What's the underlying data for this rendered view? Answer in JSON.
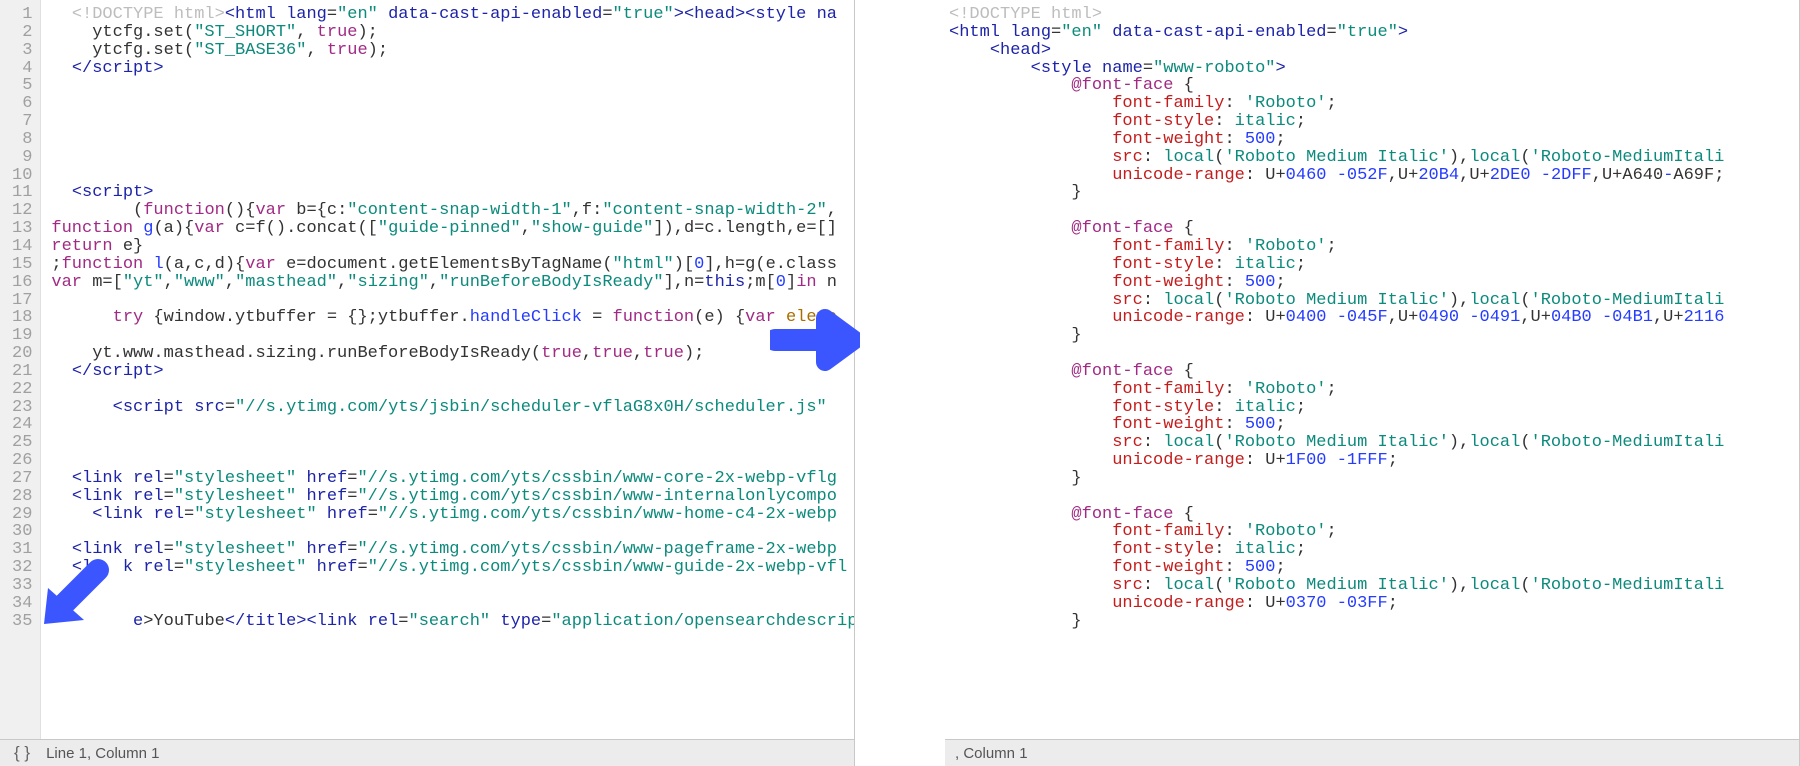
{
  "left": {
    "status": {
      "braces": "{ }",
      "location": "Line 1, Column 1"
    },
    "lines": [
      {
        "n": 1,
        "html": "  <span class='tok-doctype'>&lt;!DOCTYPE html&gt;</span><span class='tok-tag'>&lt;html</span> <span class='tok-attrname'>lang</span>=<span class='tok-string'>\"en\"</span> <span class='tok-attrname'>data-cast-api-enabled</span>=<span class='tok-string'>\"true\"</span><span class='tok-tag'>&gt;&lt;head&gt;&lt;style</span> <span class='tok-attrname'>na</span>"
      },
      {
        "n": 2,
        "html": "    ytcfg.set(<span class='tok-string'>\"ST_SHORT\"</span>, <span class='tok-keyword'>true</span>);"
      },
      {
        "n": 3,
        "html": "    ytcfg.set(<span class='tok-string'>\"ST_BASE36\"</span>, <span class='tok-keyword'>true</span>);"
      },
      {
        "n": 4,
        "html": "  <span class='tok-tag'>&lt;/script&gt;</span>"
      },
      {
        "n": 5,
        "html": " "
      },
      {
        "n": 6,
        "html": " "
      },
      {
        "n": 7,
        "html": " "
      },
      {
        "n": 8,
        "html": " "
      },
      {
        "n": 9,
        "html": " "
      },
      {
        "n": 10,
        "html": " "
      },
      {
        "n": 11,
        "html": "  <span class='tok-tag'>&lt;script&gt;</span>"
      },
      {
        "n": 12,
        "html": "        (<span class='tok-keyword'>function</span>(){<span class='tok-keyword'>var</span> b={c:<span class='tok-string'>\"content-snap-width-1\"</span>,f:<span class='tok-string'>\"content-snap-width-2\"</span>,"
      },
      {
        "n": 13,
        "html": "<span class='tok-keyword'>function</span> <span class='tok-func'>g</span>(a){<span class='tok-keyword'>var</span> c=f().concat([<span class='tok-string'>\"guide-pinned\"</span>,<span class='tok-string'>\"show-guide\"</span>]),d=c.length,e=[]"
      },
      {
        "n": 14,
        "html": "<span class='tok-keyword'>return</span> e}"
      },
      {
        "n": 15,
        "html": ";<span class='tok-keyword'>function</span> <span class='tok-func'>l</span>(a,c,d){<span class='tok-keyword'>var</span> e=document.getElementsByTagName(<span class='tok-string'>\"html\"</span>)[<span class='tok-num'>0</span>],h=g(e.class"
      },
      {
        "n": 16,
        "html": "<span class='tok-keyword'>var</span> m=[<span class='tok-string'>\"yt\"</span>,<span class='tok-string'>\"www\"</span>,<span class='tok-string'>\"masthead\"</span>,<span class='tok-string'>\"sizing\"</span>,<span class='tok-string'>\"runBeforeBodyIsReady\"</span>],n=<span class='tok-navy'>this</span>;m[<span class='tok-num'>0</span>]<span class='tok-keyword'>in</span> n"
      },
      {
        "n": 17,
        "html": " "
      },
      {
        "n": 18,
        "html": "      <span class='tok-keyword'>try</span> {window.ytbuffer = {};ytbuffer.<span class='tok-func'>handleClick</span> = <span class='tok-keyword'>function</span>(e) {<span class='tok-keyword'>var</span> <span class='tok-brown'>eleme</span>"
      },
      {
        "n": 19,
        "html": " "
      },
      {
        "n": 20,
        "html": "    yt.www.masthead.sizing.runBeforeBodyIsReady(<span class='tok-keyword'>true</span>,<span class='tok-keyword'>true</span>,<span class='tok-keyword'>true</span>);"
      },
      {
        "n": 21,
        "html": "  <span class='tok-tag'>&lt;/script&gt;</span>"
      },
      {
        "n": 22,
        "html": " "
      },
      {
        "n": 23,
        "html": "      <span class='tok-tag'>&lt;script</span> <span class='tok-attrname'>src</span>=<span class='tok-string'>\"//s.ytimg.com/yts/jsbin/scheduler-vflaG8x0H/scheduler.js\"</span>"
      },
      {
        "n": 24,
        "html": " "
      },
      {
        "n": 25,
        "html": " "
      },
      {
        "n": 26,
        "html": " "
      },
      {
        "n": 27,
        "html": "  <span class='tok-tag'>&lt;link</span> <span class='tok-attrname'>rel</span>=<span class='tok-string'>\"stylesheet\"</span> <span class='tok-attrname'>href</span>=<span class='tok-string'>\"//s.ytimg.com/yts/cssbin/www-core-2x-webp-vflg</span>"
      },
      {
        "n": 28,
        "html": "  <span class='tok-tag'>&lt;link</span> <span class='tok-attrname'>rel</span>=<span class='tok-string'>\"stylesheet\"</span> <span class='tok-attrname'>href</span>=<span class='tok-string'>\"//s.ytimg.com/yts/cssbin/www-internalonlycompo</span>"
      },
      {
        "n": 29,
        "html": "    <span class='tok-tag'>&lt;link</span> <span class='tok-attrname'>rel</span>=<span class='tok-string'>\"stylesheet\"</span> <span class='tok-attrname'>href</span>=<span class='tok-string'>\"//s.ytimg.com/yts/cssbin/www-home-c4-2x-webp</span>"
      },
      {
        "n": 30,
        "html": " "
      },
      {
        "n": 31,
        "html": "  <span class='tok-tag'>&lt;link</span> <span class='tok-attrname'>rel</span>=<span class='tok-string'>\"stylesheet\"</span> <span class='tok-attrname'>href</span>=<span class='tok-string'>\"//s.ytimg.com/yts/cssbin/www-pageframe-2x-webp</span>"
      },
      {
        "n": 32,
        "html": "  <span class='tok-tag'>&lt;l</span>   <span class='tok-attrname'>k rel</span>=<span class='tok-string'>\"stylesheet\"</span> <span class='tok-attrname'>href</span>=<span class='tok-string'>\"//s.ytimg.com/yts/cssbin/www-guide-2x-webp-vfl</span>"
      },
      {
        "n": 33,
        "html": " "
      },
      {
        "n": 34,
        "html": " "
      },
      {
        "n": 35,
        "html": "        <span class='tok-tag'>e</span>&gt;YouTube<span class='tok-tag'>&lt;/title&gt;&lt;link</span> <span class='tok-attrname'>rel</span>=<span class='tok-string'>\"search\"</span> <span class='tok-attrname'>type</span>=<span class='tok-string'>\"application/opensearchdescripti</span>"
      }
    ]
  },
  "right": {
    "status": {
      "location": ", Column 1"
    },
    "lines": [
      {
        "html": "<span class='tok-doctype'>&lt;!DOCTYPE html&gt;</span>"
      },
      {
        "html": "<span class='tok-tag'>&lt;html</span> <span class='tok-attrname'>lang</span>=<span class='tok-string'>\"en\"</span> <span class='tok-attrname'>data-cast-api-enabled</span>=<span class='tok-string'>\"true\"</span><span class='tok-tag'>&gt;</span>"
      },
      {
        "html": "    <span class='tok-tag'>&lt;head&gt;</span>"
      },
      {
        "html": "        <span class='tok-tag'>&lt;style</span> <span class='tok-attrname'>name</span>=<span class='tok-string'>\"www-roboto\"</span><span class='tok-tag'>&gt;</span>"
      },
      {
        "html": "            <span class='tok-keyword'>@font-face</span> {"
      },
      {
        "html": "                <span class='tok-red'>font-family</span>: <span class='tok-green'>'Roboto'</span>;"
      },
      {
        "html": "                <span class='tok-red'>font-style</span>: <span class='tok-green'>italic</span>;"
      },
      {
        "html": "                <span class='tok-red'>font-weight</span>: <span class='tok-num'>500</span>;"
      },
      {
        "html": "                <span class='tok-red'>src</span>: <span class='tok-green'>local</span>(<span class='tok-green'>'Roboto Medium Italic'</span>),<span class='tok-green'>local</span>(<span class='tok-green'>'Roboto-MediumItali</span>"
      },
      {
        "html": "                <span class='tok-red'>unicode-range</span>: U+<span class='tok-num'>0460</span> <span class='tok-num'>-052F</span>,U+<span class='tok-num'>20B4</span>,U+<span class='tok-num'>2DE0</span> <span class='tok-num'>-2DFF</span>,U+A640<span class='tok-num'>-</span>A69F;"
      },
      {
        "html": "            }"
      },
      {
        "html": " "
      },
      {
        "html": "            <span class='tok-keyword'>@font-face</span> {"
      },
      {
        "html": "                <span class='tok-red'>font-family</span>: <span class='tok-green'>'Roboto'</span>;"
      },
      {
        "html": "                <span class='tok-red'>font-style</span>: <span class='tok-green'>italic</span>;"
      },
      {
        "html": "                <span class='tok-red'>font-weight</span>: <span class='tok-num'>500</span>;"
      },
      {
        "html": "                <span class='tok-red'>src</span>: <span class='tok-green'>local</span>(<span class='tok-green'>'Roboto Medium Italic'</span>),<span class='tok-green'>local</span>(<span class='tok-green'>'Roboto-MediumItali</span>"
      },
      {
        "html": "                <span class='tok-red'>unicode-range</span>: U+<span class='tok-num'>0400</span> <span class='tok-num'>-045F</span>,U+<span class='tok-num'>0490</span> <span class='tok-num'>-0491</span>,U+<span class='tok-num'>04B0</span> <span class='tok-num'>-04B1</span>,U+<span class='tok-num'>2116</span>"
      },
      {
        "html": "            }"
      },
      {
        "html": " "
      },
      {
        "html": "            <span class='tok-keyword'>@font-face</span> {"
      },
      {
        "html": "                <span class='tok-red'>font-family</span>: <span class='tok-green'>'Roboto'</span>;"
      },
      {
        "html": "                <span class='tok-red'>font-style</span>: <span class='tok-green'>italic</span>;"
      },
      {
        "html": "                <span class='tok-red'>font-weight</span>: <span class='tok-num'>500</span>;"
      },
      {
        "html": "                <span class='tok-red'>src</span>: <span class='tok-green'>local</span>(<span class='tok-green'>'Roboto Medium Italic'</span>),<span class='tok-green'>local</span>(<span class='tok-green'>'Roboto-MediumItali</span>"
      },
      {
        "html": "                <span class='tok-red'>unicode-range</span>: U+<span class='tok-num'>1F00</span> <span class='tok-num'>-1FFF</span>;"
      },
      {
        "html": "            }"
      },
      {
        "html": " "
      },
      {
        "html": "            <span class='tok-keyword'>@font-face</span> {"
      },
      {
        "html": "                <span class='tok-red'>font-family</span>: <span class='tok-green'>'Roboto'</span>;"
      },
      {
        "html": "                <span class='tok-red'>font-style</span>: <span class='tok-green'>italic</span>;"
      },
      {
        "html": "                <span class='tok-red'>font-weight</span>: <span class='tok-num'>500</span>;"
      },
      {
        "html": "                <span class='tok-red'>src</span>: <span class='tok-green'>local</span>(<span class='tok-green'>'Roboto Medium Italic'</span>),<span class='tok-green'>local</span>(<span class='tok-green'>'Roboto-MediumItali</span>"
      },
      {
        "html": "                <span class='tok-red'>unicode-range</span>: U+<span class='tok-num'>0370</span> <span class='tok-num'>-03FF</span>;"
      },
      {
        "html": "            }"
      }
    ]
  },
  "arrows": {
    "right_color": "#3b56ff",
    "down_left_color": "#3b56ff"
  }
}
